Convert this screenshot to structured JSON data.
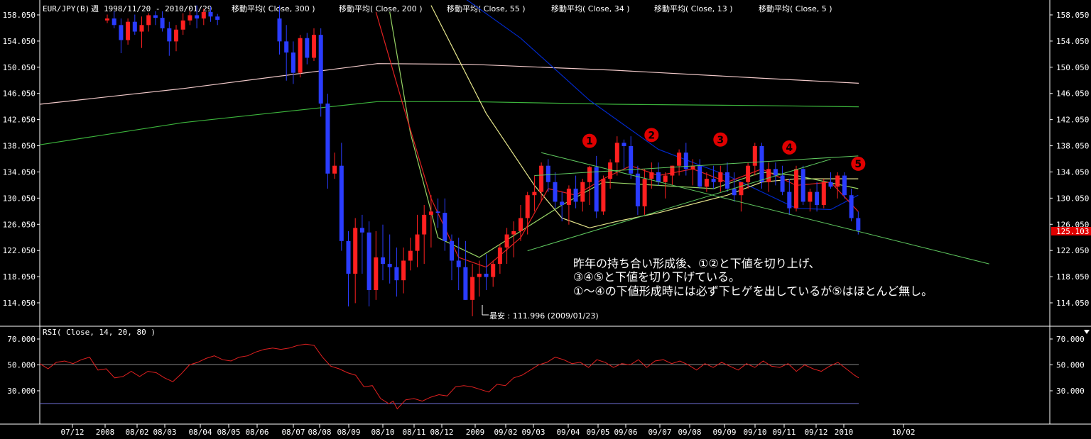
{
  "header": {
    "symbol": "EUR/JPY(B)",
    "period": "週",
    "range": "1998/11/20 - 2010/01/29",
    "ma_labels": [
      "移動平均( Close, 300 )",
      "移動平均( Close, 200 )",
      "移動平均( Close, 55 )",
      "移動平均( Close, 34 )",
      "移動平均( Close, 13 )",
      "移動平均( Close, 5 )"
    ]
  },
  "price_axis": {
    "ticks": [
      "158.050",
      "154.050",
      "150.050",
      "146.050",
      "142.050",
      "138.050",
      "134.050",
      "130.050",
      "126.050",
      "122.050",
      "118.050",
      "114.050"
    ],
    "current_price": "125.103"
  },
  "rsi_panel": {
    "title": "RSI( Close, 14, 20, 80 )",
    "ticks": [
      "70.000",
      "50.000",
      "30.000"
    ]
  },
  "time_axis": {
    "labels": [
      "07/12",
      "2008",
      "08/02",
      "08/03",
      "08/04",
      "08/05",
      "08/06",
      "08/07",
      "08/08",
      "08/09",
      "08/10",
      "08/11",
      "08/12",
      "2009",
      "09/02",
      "09/03",
      "09/04",
      "09/05",
      "09/06",
      "09/07",
      "09/08",
      "09/09",
      "09/10",
      "09/11",
      "09/12",
      "2010",
      "10/02"
    ]
  },
  "annotations": {
    "low_label": "最安 : 111.996 (2009/01/23)",
    "markers": [
      "1",
      "2",
      "3",
      "4",
      "5"
    ],
    "comment": [
      "昨年の持ち合い形成後、①②と下値を切り上げ、",
      "③④⑤と下値を切り下げている。",
      "①～④の下値形成時には必ず下ヒゲを出しているが⑤はほとんど無し。"
    ]
  },
  "colors": {
    "background": "#000000",
    "up_candle": "#ff2020",
    "down_candle": "#2a3cff",
    "ma300": "#f0c8c8",
    "ma200": "#3cb43c",
    "ma55": "#0028c8",
    "ma34": "#e6e68c",
    "ma13": "#96d264",
    "ma5": "#e02020",
    "rsi": "#e02020",
    "trendline": "#5fc85f",
    "marker": "#e00000",
    "price_box": "#e00000"
  },
  "chart_data": {
    "type": "candlestick",
    "x_unit": "week",
    "weekly_ohlc": [
      [
        0,
        157.2,
        158.1,
        156.8,
        157.5
      ],
      [
        1,
        157.5,
        158.6,
        156.0,
        156.5
      ],
      [
        2,
        156.5,
        157.5,
        152.2,
        154.2
      ],
      [
        3,
        154.2,
        157.5,
        153.5,
        157.0
      ],
      [
        4,
        157.0,
        158.1,
        155.0,
        155.5
      ],
      [
        5,
        155.5,
        157.8,
        153.0,
        156.5
      ],
      [
        6,
        156.5,
        158.3,
        155.5,
        158.0
      ],
      [
        7,
        158.0,
        158.6,
        156.5,
        157.6
      ],
      [
        8,
        157.6,
        158.6,
        155.5,
        156.0
      ],
      [
        9,
        156.0,
        157.0,
        151.8,
        154.0
      ],
      [
        10,
        154.0,
        156.5,
        152.5,
        155.8
      ],
      [
        11,
        155.8,
        158.3,
        155.0,
        157.2
      ],
      [
        12,
        157.2,
        158.6,
        156.5,
        158.0
      ],
      [
        13,
        158.0,
        159.5,
        156.0,
        157.5
      ],
      [
        14,
        157.5,
        159.0,
        156.5,
        158.5
      ],
      [
        15,
        158.5,
        159.3,
        157.0,
        157.8
      ],
      [
        16,
        157.8,
        158.2,
        156.5,
        157.3
      ],
      [
        25,
        157.5,
        159.5,
        152.0,
        154.0
      ],
      [
        26,
        154.0,
        156.5,
        148.0,
        152.3
      ],
      [
        27,
        152.3,
        154.0,
        147.5,
        149.2
      ],
      [
        28,
        149.2,
        155.0,
        148.5,
        154.5
      ],
      [
        29,
        154.5,
        155.3,
        150.5,
        151.5
      ],
      [
        30,
        151.5,
        156.0,
        151.0,
        155.0
      ],
      [
        31,
        155.0,
        156.0,
        142.5,
        144.5
      ],
      [
        32,
        144.5,
        146.0,
        131.5,
        133.8
      ],
      [
        33,
        133.8,
        137.0,
        133.0,
        135.0
      ],
      [
        34,
        135.0,
        138.5,
        122.0,
        123.5
      ],
      [
        35,
        123.5,
        125.0,
        113.5,
        118.5
      ],
      [
        36,
        118.5,
        127.0,
        114.0,
        125.5
      ],
      [
        37,
        125.5,
        127.5,
        118.5,
        124.8
      ],
      [
        38,
        124.8,
        126.5,
        113.5,
        116.0
      ],
      [
        39,
        116.0,
        125.0,
        114.5,
        121.0
      ],
      [
        40,
        121.0,
        126.0,
        117.5,
        120.0
      ],
      [
        41,
        120.0,
        124.5,
        117.0,
        119.5
      ],
      [
        42,
        119.5,
        122.5,
        115.0,
        117.5
      ],
      [
        43,
        117.5,
        122.5,
        115.5,
        120.5
      ],
      [
        44,
        120.5,
        124.0,
        119.0,
        122.0
      ],
      [
        45,
        122.0,
        127.5,
        119.5,
        124.5
      ],
      [
        46,
        124.5,
        129.0,
        120.0,
        127.5
      ],
      [
        47,
        127.5,
        130.5,
        122.5,
        128.0
      ],
      [
        48,
        128.0,
        130.0,
        125.5,
        127.8
      ],
      [
        49,
        127.8,
        130.0,
        122.0,
        123.5
      ],
      [
        50,
        123.5,
        124.5,
        117.5,
        120.5
      ],
      [
        51,
        120.5,
        124.0,
        116.0,
        119.5
      ],
      [
        52,
        119.5,
        123.5,
        114.5,
        114.5
      ],
      [
        53,
        114.5,
        120.0,
        112.0,
        118.0
      ],
      [
        54,
        118.0,
        120.5,
        115.0,
        118.5
      ],
      [
        55,
        118.5,
        121.5,
        116.0,
        118.0
      ],
      [
        56,
        118.0,
        120.5,
        116.5,
        120.0
      ],
      [
        57,
        120.0,
        123.0,
        118.5,
        122.5
      ],
      [
        58,
        122.5,
        125.5,
        120.0,
        124.5
      ],
      [
        59,
        124.5,
        126.5,
        121.0,
        125.0
      ],
      [
        60,
        125.0,
        129.0,
        123.5,
        127.0
      ],
      [
        61,
        127.0,
        131.0,
        124.5,
        130.5
      ],
      [
        62,
        130.5,
        133.5,
        128.0,
        131.0
      ],
      [
        63,
        131.0,
        135.5,
        129.5,
        135.0
      ],
      [
        64,
        135.0,
        136.0,
        131.0,
        132.5
      ],
      [
        65,
        132.5,
        134.0,
        128.5,
        129.5
      ],
      [
        66,
        129.5,
        131.0,
        126.5,
        129.0
      ],
      [
        67,
        129.0,
        132.0,
        126.0,
        131.5
      ],
      [
        68,
        131.5,
        133.5,
        128.5,
        129.5
      ],
      [
        69,
        129.5,
        133.0,
        128.0,
        132.5
      ],
      [
        70,
        132.5,
        135.0,
        129.0,
        134.8
      ],
      [
        71,
        134.8,
        136.5,
        127.0,
        128.0
      ],
      [
        72,
        128.0,
        133.5,
        127.5,
        133.0
      ],
      [
        73,
        133.0,
        136.0,
        131.5,
        135.5
      ],
      [
        74,
        135.5,
        139.5,
        133.5,
        138.5
      ],
      [
        75,
        138.5,
        139.0,
        134.5,
        138.0
      ],
      [
        76,
        138.0,
        139.5,
        133.0,
        133.8
      ],
      [
        77,
        133.8,
        135.0,
        127.5,
        128.8
      ],
      [
        78,
        128.8,
        134.5,
        127.5,
        133.0
      ],
      [
        79,
        133.0,
        135.5,
        131.5,
        134.0
      ],
      [
        80,
        134.0,
        135.5,
        132.0,
        132.5
      ],
      [
        81,
        132.5,
        134.0,
        130.0,
        133.5
      ],
      [
        82,
        133.5,
        135.0,
        132.0,
        135.0
      ],
      [
        83,
        135.0,
        137.5,
        133.5,
        137.0
      ],
      [
        84,
        137.0,
        138.5,
        133.5,
        134.5
      ],
      [
        85,
        134.5,
        136.0,
        132.0,
        135.0
      ],
      [
        86,
        135.0,
        136.0,
        131.5,
        131.8
      ],
      [
        87,
        131.8,
        134.0,
        131.0,
        133.0
      ],
      [
        88,
        133.0,
        135.0,
        131.5,
        132.5
      ],
      [
        89,
        132.5,
        135.0,
        131.0,
        134.0
      ],
      [
        90,
        134.0,
        135.5,
        131.0,
        131.5
      ],
      [
        91,
        131.5,
        134.0,
        129.5,
        130.5
      ],
      [
        92,
        130.5,
        132.5,
        128.0,
        132.5
      ],
      [
        93,
        132.5,
        135.5,
        131.5,
        135.0
      ],
      [
        94,
        135.0,
        138.5,
        133.5,
        138.0
      ],
      [
        95,
        138.0,
        138.5,
        131.5,
        132.5
      ],
      [
        96,
        132.5,
        135.5,
        131.0,
        134.5
      ],
      [
        97,
        134.5,
        135.5,
        132.0,
        133.5
      ],
      [
        98,
        133.5,
        135.0,
        130.5,
        131.0
      ],
      [
        99,
        131.0,
        133.0,
        127.5,
        128.5
      ],
      [
        100,
        128.5,
        135.0,
        128.0,
        134.5
      ],
      [
        101,
        134.5,
        135.0,
        129.0,
        129.5
      ],
      [
        102,
        129.5,
        131.5,
        128.0,
        131.0
      ],
      [
        103,
        131.0,
        132.5,
        128.0,
        129.0
      ],
      [
        104,
        129.0,
        133.0,
        128.5,
        132.5
      ],
      [
        105,
        132.5,
        134.0,
        131.5,
        131.8
      ],
      [
        106,
        131.8,
        134.0,
        130.0,
        133.5
      ],
      [
        107,
        133.5,
        134.0,
        130.0,
        130.5
      ],
      [
        108,
        130.5,
        131.5,
        126.5,
        127.0
      ],
      [
        109,
        127.0,
        128.0,
        124.5,
        125.103
      ]
    ],
    "ma300": [
      [
        0,
        144.4
      ],
      [
        20,
        146.8
      ],
      [
        47,
        150.6
      ],
      [
        60,
        150.5
      ],
      [
        80,
        149.6
      ],
      [
        100,
        148.4
      ],
      [
        114,
        147.6
      ]
    ],
    "ma200": [
      [
        0,
        138.2
      ],
      [
        20,
        141.6
      ],
      [
        47,
        144.8
      ],
      [
        60,
        144.8
      ],
      [
        80,
        144.4
      ],
      [
        100,
        144.2
      ],
      [
        114,
        144.0
      ]
    ],
    "ma55": [
      [
        52,
        160.5
      ],
      [
        60,
        154.5
      ],
      [
        70,
        145.0
      ],
      [
        80,
        137.5
      ],
      [
        90,
        133.5
      ],
      [
        100,
        128.5
      ],
      [
        105,
        128.3
      ],
      [
        109,
        130.5
      ]
    ],
    "ma34": [
      [
        47,
        159.5
      ],
      [
        55,
        143.0
      ],
      [
        62,
        132.0
      ],
      [
        66,
        127.0
      ],
      [
        70,
        125.5
      ],
      [
        74,
        126.5
      ],
      [
        80,
        127.8
      ],
      [
        90,
        130.5
      ],
      [
        95,
        132.5
      ],
      [
        100,
        133.0
      ],
      [
        109,
        133.0
      ]
    ],
    "ma13": [
      [
        41,
        158.5
      ],
      [
        44,
        140.0
      ],
      [
        48,
        124.0
      ],
      [
        54,
        121.0
      ],
      [
        60,
        125.0
      ],
      [
        66,
        129.0
      ],
      [
        72,
        132.5
      ],
      [
        80,
        132.0
      ],
      [
        88,
        131.5
      ],
      [
        95,
        134.0
      ],
      [
        100,
        133.5
      ],
      [
        109,
        131.5
      ]
    ],
    "ma5": [
      [
        39,
        158.5
      ],
      [
        43,
        144.0
      ],
      [
        47,
        130.0
      ],
      [
        51,
        121.0
      ],
      [
        55,
        119.5
      ],
      [
        60,
        124.0
      ],
      [
        64,
        131.5
      ],
      [
        68,
        130.5
      ],
      [
        72,
        133.0
      ],
      [
        76,
        135.0
      ],
      [
        80,
        133.5
      ],
      [
        85,
        134.5
      ],
      [
        90,
        132.5
      ],
      [
        95,
        134.5
      ],
      [
        100,
        132.0
      ],
      [
        105,
        132.5
      ],
      [
        109,
        128.0
      ]
    ],
    "trendlines": [
      [
        [
          63,
          137.0
        ],
        [
          128,
          120.0
        ]
      ],
      [
        [
          61,
          122.0
        ],
        [
          105,
          136.0
        ]
      ],
      [
        [
          62,
          133.5
        ],
        [
          109,
          136.5
        ]
      ]
    ],
    "markers_at": [
      [
        70,
        138.8
      ],
      [
        79,
        139.7
      ],
      [
        89,
        139.0
      ],
      [
        99,
        137.8
      ],
      [
        109,
        135.3
      ]
    ],
    "rsi": [
      [
        0,
        51
      ],
      [
        2,
        47
      ],
      [
        4,
        52
      ],
      [
        6,
        53
      ],
      [
        8,
        51
      ],
      [
        10,
        54
      ],
      [
        12,
        56
      ],
      [
        14,
        46
      ],
      [
        16,
        47
      ],
      [
        18,
        40
      ],
      [
        20,
        41
      ],
      [
        22,
        45
      ],
      [
        24,
        41
      ],
      [
        26,
        45
      ],
      [
        28,
        44
      ],
      [
        30,
        40
      ],
      [
        32,
        37
      ],
      [
        34,
        43
      ],
      [
        36,
        50
      ],
      [
        38,
        52
      ],
      [
        40,
        55
      ],
      [
        42,
        57
      ],
      [
        44,
        54
      ],
      [
        46,
        53
      ],
      [
        48,
        56
      ],
      [
        50,
        57
      ],
      [
        52,
        60
      ],
      [
        54,
        62
      ],
      [
        56,
        63
      ],
      [
        58,
        62
      ],
      [
        60,
        63
      ],
      [
        62,
        65
      ],
      [
        64,
        66
      ],
      [
        66,
        65
      ],
      [
        68,
        56
      ],
      [
        70,
        49
      ],
      [
        72,
        47
      ],
      [
        74,
        44
      ],
      [
        76,
        42
      ],
      [
        78,
        33
      ],
      [
        80,
        34
      ],
      [
        82,
        24
      ],
      [
        84,
        20
      ],
      [
        85,
        22
      ],
      [
        86,
        16
      ],
      [
        88,
        23
      ],
      [
        90,
        24
      ],
      [
        92,
        22
      ],
      [
        94,
        25
      ],
      [
        96,
        27
      ],
      [
        98,
        26
      ],
      [
        100,
        33
      ],
      [
        102,
        34
      ],
      [
        104,
        33
      ],
      [
        106,
        31
      ],
      [
        108,
        29
      ],
      [
        110,
        35
      ],
      [
        112,
        34
      ],
      [
        114,
        40
      ],
      [
        116,
        42
      ],
      [
        118,
        46
      ],
      [
        120,
        50
      ],
      [
        122,
        52
      ],
      [
        124,
        56
      ],
      [
        126,
        54
      ],
      [
        128,
        51
      ],
      [
        130,
        52
      ],
      [
        132,
        48
      ],
      [
        134,
        54
      ],
      [
        136,
        52
      ],
      [
        138,
        48
      ],
      [
        140,
        51
      ],
      [
        142,
        50
      ],
      [
        144,
        54
      ],
      [
        146,
        48
      ],
      [
        148,
        53
      ],
      [
        150,
        54
      ],
      [
        152,
        51
      ],
      [
        154,
        53
      ],
      [
        156,
        50
      ],
      [
        158,
        46
      ],
      [
        160,
        51
      ],
      [
        162,
        48
      ],
      [
        164,
        52
      ],
      [
        166,
        49
      ],
      [
        168,
        46
      ],
      [
        170,
        51
      ],
      [
        172,
        48
      ],
      [
        174,
        53
      ],
      [
        176,
        49
      ],
      [
        178,
        48
      ],
      [
        180,
        51
      ],
      [
        182,
        45
      ],
      [
        184,
        50
      ],
      [
        186,
        47
      ],
      [
        188,
        45
      ],
      [
        190,
        49
      ],
      [
        192,
        52
      ],
      [
        194,
        47
      ],
      [
        196,
        42
      ],
      [
        197,
        40
      ]
    ],
    "ylim": [
      111.5,
      160.0
    ],
    "rsi_ylim": [
      10,
      75
    ]
  }
}
